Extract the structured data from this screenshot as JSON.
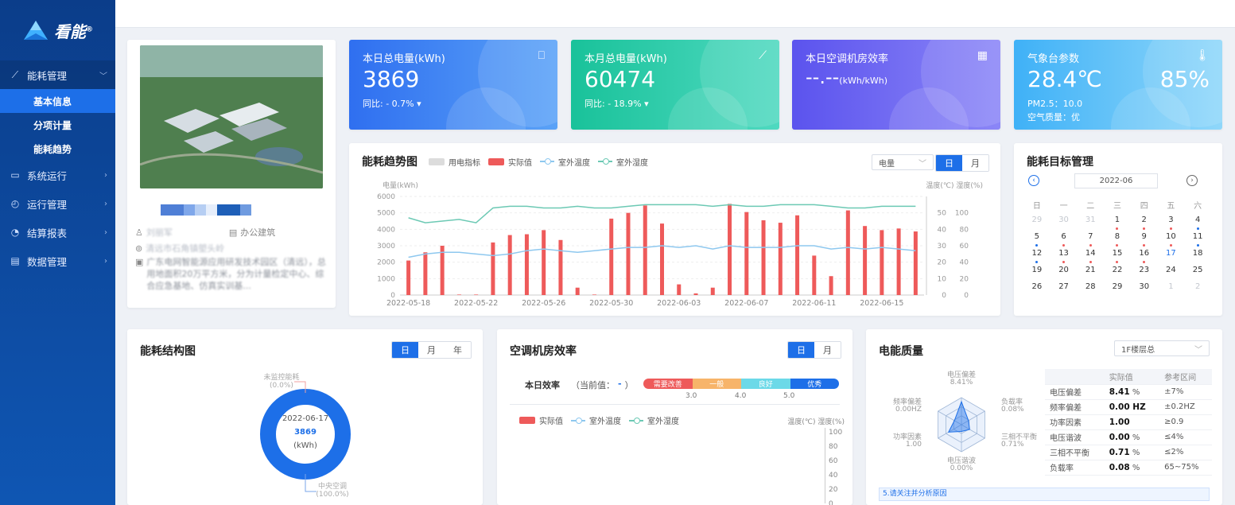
{
  "app": {
    "logo_text": "看能",
    "logo_mark": "®"
  },
  "sidebar": {
    "items": [
      {
        "label": "能耗管理",
        "icon": "line-chart-icon",
        "open": true
      },
      {
        "label": "系统运行",
        "icon": "monitor-icon"
      },
      {
        "label": "运行管理",
        "icon": "clock-icon"
      },
      {
        "label": "结算报表",
        "icon": "pie-chart-icon"
      },
      {
        "label": "数据管理",
        "icon": "table-icon"
      }
    ],
    "subitems": [
      {
        "label": "基本信息",
        "active": true
      },
      {
        "label": "分项计量"
      },
      {
        "label": "能耗趋势"
      }
    ]
  },
  "project": {
    "user": "刘丽军",
    "type": "办公建筑",
    "address": "清远市石角镇塱头岭",
    "desc": "广东电网智能源应用研发技术园区（清远），总用地面积20万平方米，分为计量检定中心、综合应急基地、仿真实训基..."
  },
  "stats": [
    {
      "label": "本日总电量(kWh)",
      "value": "3869",
      "sub": "同比: - 0.7% ▾",
      "icon": "bookmark-icon",
      "color_from": "#2f6ff0",
      "color_to": "#5aa2f7"
    },
    {
      "label": "本月总电量(kWh)",
      "value": "60474",
      "sub": "同比: - 18.9% ▾",
      "icon": "trend-icon",
      "color_from": "#19c29a",
      "color_to": "#4fd9c0"
    },
    {
      "label": "本日空调机房效率",
      "value": "--.--",
      "unit": "(kWh/kWh)",
      "icon": "calculator-icon",
      "color_from": "#5b53ee",
      "color_to": "#8b86f7"
    },
    {
      "label": "气象台参数",
      "value": "28.4℃",
      "value2": "85%",
      "sub": "PM2.5：10.0",
      "sub2": "空气质量：优",
      "icon": "thermometer-icon",
      "color_from": "#3fb1f7",
      "color_to": "#8fd7fa"
    }
  ],
  "trend": {
    "title": "能耗趋势图",
    "legend": [
      "用电指标",
      "实际值",
      "室外温度",
      "室外湿度"
    ],
    "select": "电量",
    "tabs": [
      "日",
      "月"
    ],
    "ylabel": "电量(kWh)",
    "y2label": "温度(℃) 湿度(%)"
  },
  "chart_data": {
    "type": "bar",
    "x": [
      "2022-05-18",
      "2022-05-19",
      "2022-05-20",
      "2022-05-21",
      "2022-05-22",
      "2022-05-23",
      "2022-05-24",
      "2022-05-25",
      "2022-05-26",
      "2022-05-27",
      "2022-05-28",
      "2022-05-29",
      "2022-05-30",
      "2022-05-31",
      "2022-06-01",
      "2022-06-02",
      "2022-06-03",
      "2022-06-04",
      "2022-06-05",
      "2022-06-06",
      "2022-06-07",
      "2022-06-08",
      "2022-06-09",
      "2022-06-10",
      "2022-06-11",
      "2022-06-12",
      "2022-06-13",
      "2022-06-14",
      "2022-06-15",
      "2022-06-16",
      "2022-06-17"
    ],
    "xticks": [
      "2022-05-18",
      "2022-05-22",
      "2022-05-26",
      "2022-05-30",
      "2022-06-03",
      "2022-06-07",
      "2022-06-11",
      "2022-06-15"
    ],
    "series": [
      {
        "name": "实际值",
        "color": "#ee5a5a",
        "values": [
          2100,
          2600,
          3000,
          30,
          30,
          3200,
          3650,
          3700,
          3950,
          3350,
          450,
          30,
          4650,
          5000,
          5450,
          4350,
          650,
          100,
          450,
          5550,
          5050,
          4550,
          4400,
          4850,
          2400,
          1150,
          5150,
          4200,
          3950,
          4050,
          3869
        ]
      },
      {
        "name": "室外温度",
        "color": "#8ec8ef",
        "values": [
          23,
          25,
          26,
          26,
          25,
          24,
          25,
          27,
          28,
          27,
          26,
          27,
          28,
          29,
          29,
          30,
          29,
          30,
          28,
          30,
          29,
          29,
          29,
          30,
          30,
          28,
          29,
          28,
          29,
          28,
          27
        ]
      },
      {
        "name": "室外湿度",
        "color": "#6cc9b4",
        "values": [
          47,
          44,
          45,
          46,
          44,
          53,
          54,
          54,
          53,
          53,
          54,
          53,
          53,
          54,
          55,
          55,
          55,
          55,
          54,
          55,
          54,
          54,
          55,
          55,
          55,
          54,
          53,
          53,
          54,
          54,
          54
        ]
      }
    ],
    "ylim": [
      0,
      6000
    ],
    "yticks": [
      0,
      1000,
      2000,
      3000,
      4000,
      5000,
      6000
    ],
    "y2ticks_temp": [
      0,
      10,
      20,
      30,
      40,
      50
    ],
    "y2ticks_hum": [
      0,
      20,
      40,
      60,
      80,
      100
    ]
  },
  "calendar": {
    "title": "能耗目标管理",
    "month": "2022-06",
    "weekdays": [
      "日",
      "一",
      "二",
      "三",
      "四",
      "五",
      "六"
    ],
    "days": [
      {
        "d": "29",
        "dim": true
      },
      {
        "d": "30",
        "dim": true
      },
      {
        "d": "31",
        "dim": true
      },
      {
        "d": "1",
        "dot": "#ee5a5a"
      },
      {
        "d": "2",
        "dot": "#ee5a5a"
      },
      {
        "d": "3",
        "dot": "#ee5a5a"
      },
      {
        "d": "4",
        "dot": "#1d6fe8"
      },
      {
        "d": "5",
        "dot": "#1d6fe8"
      },
      {
        "d": "6",
        "dot": "#ee5a5a"
      },
      {
        "d": "7",
        "dot": "#ee5a5a"
      },
      {
        "d": "8",
        "dot": "#ee5a5a"
      },
      {
        "d": "9",
        "dot": "#ee5a5a"
      },
      {
        "d": "10",
        "dot": "#ee5a5a"
      },
      {
        "d": "11",
        "dot": "#1d6fe8"
      },
      {
        "d": "12",
        "dot": "#1d6fe8"
      },
      {
        "d": "13",
        "dot": "#ee5a5a"
      },
      {
        "d": "14",
        "dot": "#ee5a5a"
      },
      {
        "d": "15",
        "dot": "#ee5a5a"
      },
      {
        "d": "16",
        "dot": "#ee5a5a"
      },
      {
        "d": "17",
        "today": true
      },
      {
        "d": "18"
      },
      {
        "d": "19"
      },
      {
        "d": "20"
      },
      {
        "d": "21"
      },
      {
        "d": "22"
      },
      {
        "d": "23"
      },
      {
        "d": "24"
      },
      {
        "d": "25"
      },
      {
        "d": "26"
      },
      {
        "d": "27"
      },
      {
        "d": "28"
      },
      {
        "d": "29"
      },
      {
        "d": "30"
      },
      {
        "d": "1",
        "dim": true
      },
      {
        "d": "2",
        "dim": true
      }
    ]
  },
  "structure": {
    "title": "能耗结构图",
    "tabs": [
      "日",
      "月",
      "年"
    ],
    "center_date": "2022-06-17",
    "center_value": "3869",
    "center_unit": "(kWh)",
    "label_top": "未监控能耗",
    "label_top_pct": "(0.0%)",
    "label_bottom": "中央空调",
    "label_bottom_pct": "(100.0%)"
  },
  "ac_room": {
    "title": "空调机房效率",
    "tabs": [
      "日",
      "月"
    ],
    "eff_label": "本日效率",
    "current_prefix": "（当前值：",
    "current_value": "-",
    "current_suffix": "）",
    "bands": [
      "需要改善",
      "一般",
      "良好",
      "优秀"
    ],
    "band_ticks": [
      "3.0",
      "4.0",
      "5.0"
    ],
    "legend": [
      "实际值",
      "室外温度",
      "室外湿度"
    ],
    "y2label": "温度(℃) 湿度(%)",
    "y2ticks": [
      "100",
      "80",
      "60",
      "40",
      "20",
      "0"
    ]
  },
  "quality": {
    "title": "电能质量",
    "select": "1F楼层总",
    "radar_labels": [
      {
        "name": "电压偏差",
        "val": "8.41%"
      },
      {
        "name": "负载率",
        "val": "0.08%"
      },
      {
        "name": "三相不平衡",
        "val": "0.71%"
      },
      {
        "name": "电压谐波",
        "val": "0.00%"
      },
      {
        "name": "功率因素",
        "val": "1.00"
      },
      {
        "name": "频率偏差",
        "val": "0.00HZ"
      }
    ],
    "table_head": [
      "",
      "实际值",
      "参考区间"
    ],
    "rows": [
      {
        "name": "电压偏差",
        "val": "8.41",
        "unit": " %",
        "ref": "±7%"
      },
      {
        "name": "频率偏差",
        "val": "0.00 HZ",
        "unit": "",
        "ref": "±0.2HZ"
      },
      {
        "name": "功率因素",
        "val": "1.00",
        "unit": "",
        "ref": "≥0.9"
      },
      {
        "name": "电压谐波",
        "val": "0.00",
        "unit": " %",
        "ref": "≤4%"
      },
      {
        "name": "三相不平衡",
        "val": "0.71",
        "unit": " %",
        "ref": "≤2%"
      },
      {
        "name": "负载率",
        "val": "0.08",
        "unit": " %",
        "ref": "65~75%"
      }
    ],
    "notice": "5.请关注并分析原因"
  }
}
